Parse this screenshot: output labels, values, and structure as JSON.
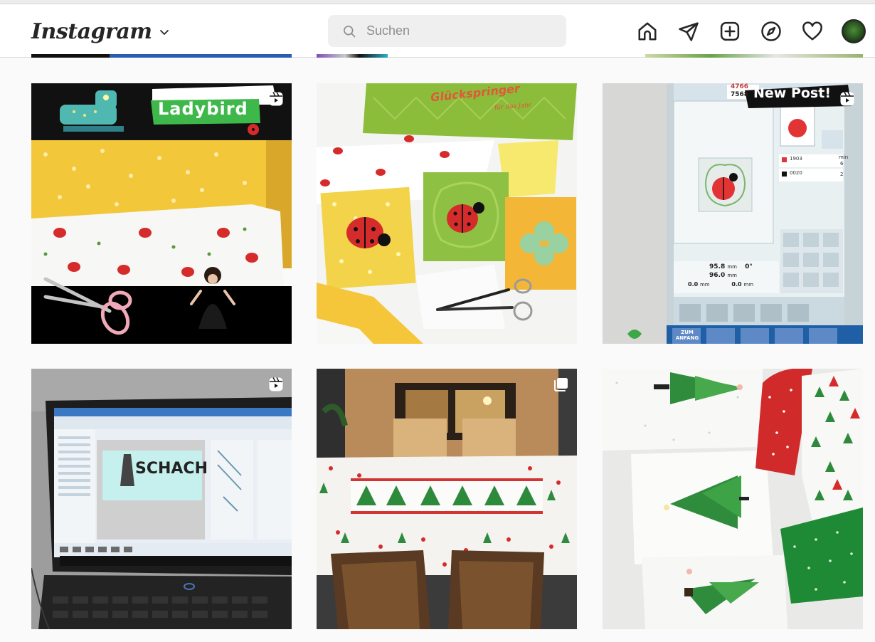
{
  "header": {
    "logo_text": "Instagram",
    "search_placeholder": "Suchen",
    "icons": [
      "home-icon",
      "direct-message-icon",
      "new-post-icon",
      "explore-icon",
      "activity-heart-icon",
      "profile-avatar"
    ]
  },
  "posts": [
    {
      "type": "reel",
      "overlay_text": "Ladybird",
      "icon": "reels-icon"
    },
    {
      "type": "photo",
      "overlay_text": "Glückspringer",
      "overlay_subtext": "für das Jahr"
    },
    {
      "type": "reel",
      "overlay_text": "New Post!",
      "icon": "reels-icon",
      "screen": {
        "stitch_top": "4766",
        "stitch_bottom": "7568",
        "color_1_code": "1903",
        "color_2_code": "0020",
        "min_label": "min",
        "min_value_1": "6",
        "min_value_2": "2",
        "width": "95.8",
        "height": "96.0",
        "unit": "mm",
        "angle": "0°",
        "offset_x": "0.0",
        "offset_y": "0.0",
        "button_label_1": "ZUM",
        "button_label_2": "ANFANG"
      }
    },
    {
      "type": "reel",
      "overlay_text": "SCHACH",
      "icon": "reels-icon"
    },
    {
      "type": "carousel",
      "icon": "carousel-icon"
    },
    {
      "type": "photo"
    }
  ],
  "colors": {
    "border": "#dbdbdb",
    "search_bg": "#efefef",
    "text": "#262626",
    "placeholder": "#8e8e8e",
    "page_bg": "#fafafa"
  }
}
